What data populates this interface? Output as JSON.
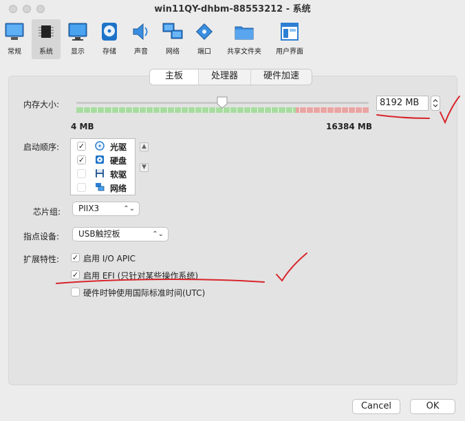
{
  "window": {
    "title": "win11QY-dhbm-88553212 - 系统"
  },
  "toolbar": {
    "items": [
      {
        "label": "常规",
        "icon": "general-icon"
      },
      {
        "label": "系统",
        "icon": "system-chip-icon"
      },
      {
        "label": "显示",
        "icon": "display-monitor-icon"
      },
      {
        "label": "存储",
        "icon": "storage-disk-icon"
      },
      {
        "label": "声音",
        "icon": "audio-speaker-icon"
      },
      {
        "label": "网络",
        "icon": "network-icon"
      },
      {
        "label": "端口",
        "icon": "ports-icon"
      },
      {
        "label": "共享文件夹",
        "icon": "shared-folder-icon"
      },
      {
        "label": "用户界面",
        "icon": "user-interface-icon"
      }
    ],
    "selected": "系统"
  },
  "tabs": [
    {
      "label": "主板",
      "active": true
    },
    {
      "label": "处理器",
      "active": false
    },
    {
      "label": "硬件加速",
      "active": false
    }
  ],
  "memory": {
    "label": "内存大小:",
    "value": "8192 MB",
    "min_label": "4 MB",
    "max_label": "16384 MB",
    "slider_value_mb": 8192,
    "slider_min_mb": 4,
    "slider_max_mb": 16384,
    "recommended_max_mb": 12288
  },
  "boot_order": {
    "label": "启动顺序:",
    "items": [
      {
        "name": "光驱",
        "checked": true,
        "icon": "optical-drive-icon"
      },
      {
        "name": "硬盘",
        "checked": true,
        "icon": "hard-disk-icon"
      },
      {
        "name": "软驱",
        "checked": false,
        "icon": "floppy-icon"
      },
      {
        "name": "网络",
        "checked": false,
        "icon": "network-boot-icon"
      }
    ]
  },
  "chipset": {
    "label": "芯片组:",
    "value": "PIIX3"
  },
  "pointing_device": {
    "label": "指点设备:",
    "value": "USB触控板"
  },
  "extended": {
    "label": "扩展特性:",
    "options": [
      {
        "label": "启用 I/O APIC",
        "checked": true
      },
      {
        "label": "启用 EFI (只针对某些操作系统)",
        "checked": true
      },
      {
        "label": "硬件时钟使用国际标准时间(UTC)",
        "checked": false
      }
    ]
  },
  "buttons": {
    "cancel": "Cancel",
    "ok": "OK"
  },
  "colors": {
    "annotation": "#d8242a",
    "slider_green": "#a8dca0",
    "slider_red": "#e9a6a4"
  }
}
